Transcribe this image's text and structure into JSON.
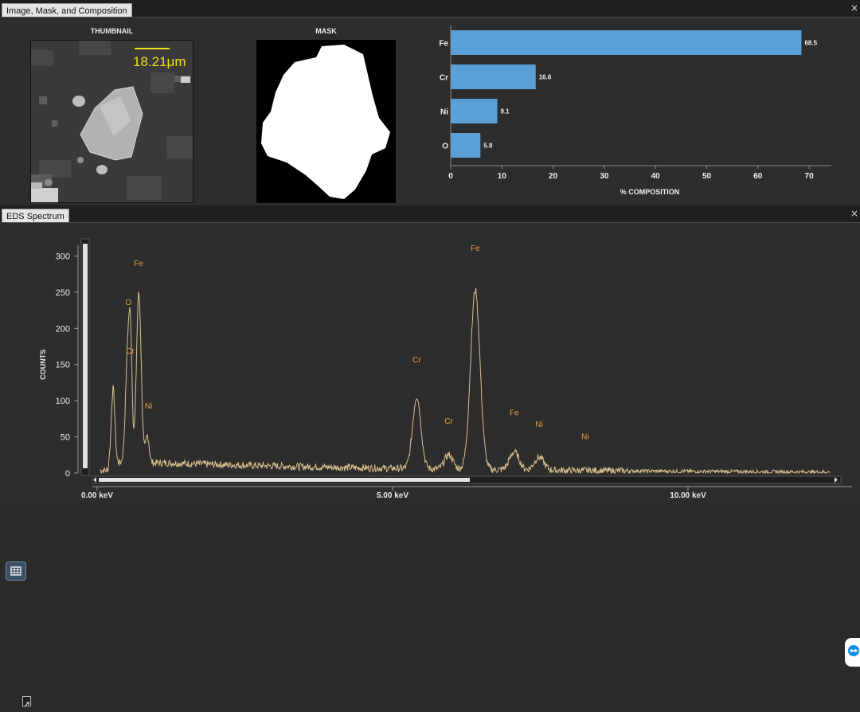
{
  "top_panel": {
    "tab_title": "Image, Mask, and Composition",
    "close_glyph": "×",
    "thumbnail_caption": "THUMBNAIL",
    "scale_label": "18.21μm",
    "mask_caption": "MASK"
  },
  "bottom_panel": {
    "tab_title": "EDS Spectrum",
    "close_glyph": "×"
  },
  "icons": {
    "table": "table-icon",
    "expand": "expand-icon",
    "teamviewer": "teamviewer-icon"
  },
  "colors": {
    "bar": "#5aa0d6",
    "spectrum_line": "#d8c08e",
    "peak_label": "#e8a040",
    "scale_bar": "#f0e21a"
  },
  "chart_data": [
    {
      "type": "bar",
      "orientation": "horizontal",
      "categories": [
        "Fe",
        "Cr",
        "Ni",
        "O"
      ],
      "values": [
        68.5,
        16.6,
        9.1,
        5.8
      ],
      "data_labels": [
        "68.5",
        "16.6",
        "9.1",
        "5.8"
      ],
      "xlabel": "% COMPOSITION",
      "xlim": [
        0,
        75
      ],
      "xticks": [
        0,
        10,
        20,
        30,
        40,
        50,
        60,
        70
      ]
    },
    {
      "type": "line",
      "ylabel": "COUNTS",
      "ylim": [
        0,
        320
      ],
      "yticks": [
        0,
        50,
        100,
        150,
        200,
        250,
        300
      ],
      "xlim": [
        0,
        12.5
      ],
      "xticks": [
        {
          "value": 0,
          "label": "0.00 keV"
        },
        {
          "value": 5,
          "label": "5.00 keV"
        },
        {
          "value": 10,
          "label": "10.00 keV"
        }
      ],
      "baseline": 14,
      "peaks": [
        {
          "x": 0.27,
          "y": 103,
          "w": 0.03
        },
        {
          "x": 0.525,
          "y": 170,
          "w": 0.04
        },
        {
          "x": 0.57,
          "y": 100,
          "w": 0.025
        },
        {
          "x": 0.705,
          "y": 235,
          "w": 0.04
        },
        {
          "x": 0.85,
          "y": 38,
          "w": 0.03
        },
        {
          "x": 5.41,
          "y": 100,
          "w": 0.07
        },
        {
          "x": 5.95,
          "y": 20,
          "w": 0.07
        },
        {
          "x": 6.4,
          "y": 248,
          "w": 0.08
        },
        {
          "x": 7.06,
          "y": 25,
          "w": 0.08
        },
        {
          "x": 7.48,
          "y": 18,
          "w": 0.08
        }
      ],
      "peak_labels": [
        {
          "text": "Fe",
          "x": 0.7,
          "y": 286
        },
        {
          "text": "O",
          "x": 0.53,
          "y": 232
        },
        {
          "text": "Cr",
          "x": 0.56,
          "y": 165
        },
        {
          "text": "Ni",
          "x": 0.87,
          "y": 89
        },
        {
          "text": "Cr",
          "x": 5.41,
          "y": 153
        },
        {
          "text": "Fe",
          "x": 6.4,
          "y": 307
        },
        {
          "text": "Cr",
          "x": 5.95,
          "y": 68
        },
        {
          "text": "Fe",
          "x": 7.06,
          "y": 80
        },
        {
          "text": "Ni",
          "x": 7.48,
          "y": 64
        },
        {
          "text": "Ni",
          "x": 8.26,
          "y": 47
        }
      ]
    }
  ]
}
